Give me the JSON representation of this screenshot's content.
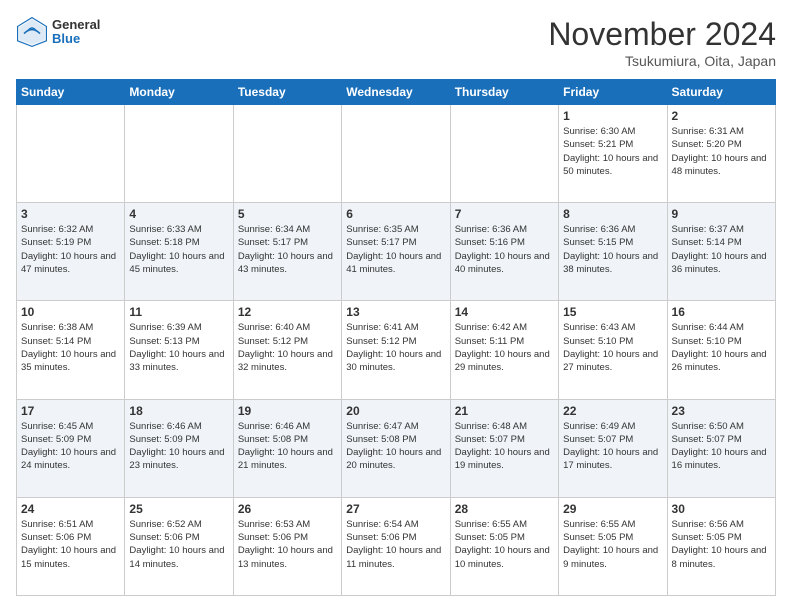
{
  "header": {
    "logo": {
      "general": "General",
      "blue": "Blue"
    },
    "title": "November 2024",
    "location": "Tsukumiura, Oita, Japan"
  },
  "calendar": {
    "headers": [
      "Sunday",
      "Monday",
      "Tuesday",
      "Wednesday",
      "Thursday",
      "Friday",
      "Saturday"
    ],
    "rows": [
      [
        {
          "day": "",
          "info": ""
        },
        {
          "day": "",
          "info": ""
        },
        {
          "day": "",
          "info": ""
        },
        {
          "day": "",
          "info": ""
        },
        {
          "day": "",
          "info": ""
        },
        {
          "day": "1",
          "info": "Sunrise: 6:30 AM\nSunset: 5:21 PM\nDaylight: 10 hours\nand 50 minutes."
        },
        {
          "day": "2",
          "info": "Sunrise: 6:31 AM\nSunset: 5:20 PM\nDaylight: 10 hours\nand 48 minutes."
        }
      ],
      [
        {
          "day": "3",
          "info": "Sunrise: 6:32 AM\nSunset: 5:19 PM\nDaylight: 10 hours\nand 47 minutes."
        },
        {
          "day": "4",
          "info": "Sunrise: 6:33 AM\nSunset: 5:18 PM\nDaylight: 10 hours\nand 45 minutes."
        },
        {
          "day": "5",
          "info": "Sunrise: 6:34 AM\nSunset: 5:17 PM\nDaylight: 10 hours\nand 43 minutes."
        },
        {
          "day": "6",
          "info": "Sunrise: 6:35 AM\nSunset: 5:17 PM\nDaylight: 10 hours\nand 41 minutes."
        },
        {
          "day": "7",
          "info": "Sunrise: 6:36 AM\nSunset: 5:16 PM\nDaylight: 10 hours\nand 40 minutes."
        },
        {
          "day": "8",
          "info": "Sunrise: 6:36 AM\nSunset: 5:15 PM\nDaylight: 10 hours\nand 38 minutes."
        },
        {
          "day": "9",
          "info": "Sunrise: 6:37 AM\nSunset: 5:14 PM\nDaylight: 10 hours\nand 36 minutes."
        }
      ],
      [
        {
          "day": "10",
          "info": "Sunrise: 6:38 AM\nSunset: 5:14 PM\nDaylight: 10 hours\nand 35 minutes."
        },
        {
          "day": "11",
          "info": "Sunrise: 6:39 AM\nSunset: 5:13 PM\nDaylight: 10 hours\nand 33 minutes."
        },
        {
          "day": "12",
          "info": "Sunrise: 6:40 AM\nSunset: 5:12 PM\nDaylight: 10 hours\nand 32 minutes."
        },
        {
          "day": "13",
          "info": "Sunrise: 6:41 AM\nSunset: 5:12 PM\nDaylight: 10 hours\nand 30 minutes."
        },
        {
          "day": "14",
          "info": "Sunrise: 6:42 AM\nSunset: 5:11 PM\nDaylight: 10 hours\nand 29 minutes."
        },
        {
          "day": "15",
          "info": "Sunrise: 6:43 AM\nSunset: 5:10 PM\nDaylight: 10 hours\nand 27 minutes."
        },
        {
          "day": "16",
          "info": "Sunrise: 6:44 AM\nSunset: 5:10 PM\nDaylight: 10 hours\nand 26 minutes."
        }
      ],
      [
        {
          "day": "17",
          "info": "Sunrise: 6:45 AM\nSunset: 5:09 PM\nDaylight: 10 hours\nand 24 minutes."
        },
        {
          "day": "18",
          "info": "Sunrise: 6:46 AM\nSunset: 5:09 PM\nDaylight: 10 hours\nand 23 minutes."
        },
        {
          "day": "19",
          "info": "Sunrise: 6:46 AM\nSunset: 5:08 PM\nDaylight: 10 hours\nand 21 minutes."
        },
        {
          "day": "20",
          "info": "Sunrise: 6:47 AM\nSunset: 5:08 PM\nDaylight: 10 hours\nand 20 minutes."
        },
        {
          "day": "21",
          "info": "Sunrise: 6:48 AM\nSunset: 5:07 PM\nDaylight: 10 hours\nand 19 minutes."
        },
        {
          "day": "22",
          "info": "Sunrise: 6:49 AM\nSunset: 5:07 PM\nDaylight: 10 hours\nand 17 minutes."
        },
        {
          "day": "23",
          "info": "Sunrise: 6:50 AM\nSunset: 5:07 PM\nDaylight: 10 hours\nand 16 minutes."
        }
      ],
      [
        {
          "day": "24",
          "info": "Sunrise: 6:51 AM\nSunset: 5:06 PM\nDaylight: 10 hours\nand 15 minutes."
        },
        {
          "day": "25",
          "info": "Sunrise: 6:52 AM\nSunset: 5:06 PM\nDaylight: 10 hours\nand 14 minutes."
        },
        {
          "day": "26",
          "info": "Sunrise: 6:53 AM\nSunset: 5:06 PM\nDaylight: 10 hours\nand 13 minutes."
        },
        {
          "day": "27",
          "info": "Sunrise: 6:54 AM\nSunset: 5:06 PM\nDaylight: 10 hours\nand 11 minutes."
        },
        {
          "day": "28",
          "info": "Sunrise: 6:55 AM\nSunset: 5:05 PM\nDaylight: 10 hours\nand 10 minutes."
        },
        {
          "day": "29",
          "info": "Sunrise: 6:55 AM\nSunset: 5:05 PM\nDaylight: 10 hours\nand 9 minutes."
        },
        {
          "day": "30",
          "info": "Sunrise: 6:56 AM\nSunset: 5:05 PM\nDaylight: 10 hours\nand 8 minutes."
        }
      ]
    ]
  }
}
